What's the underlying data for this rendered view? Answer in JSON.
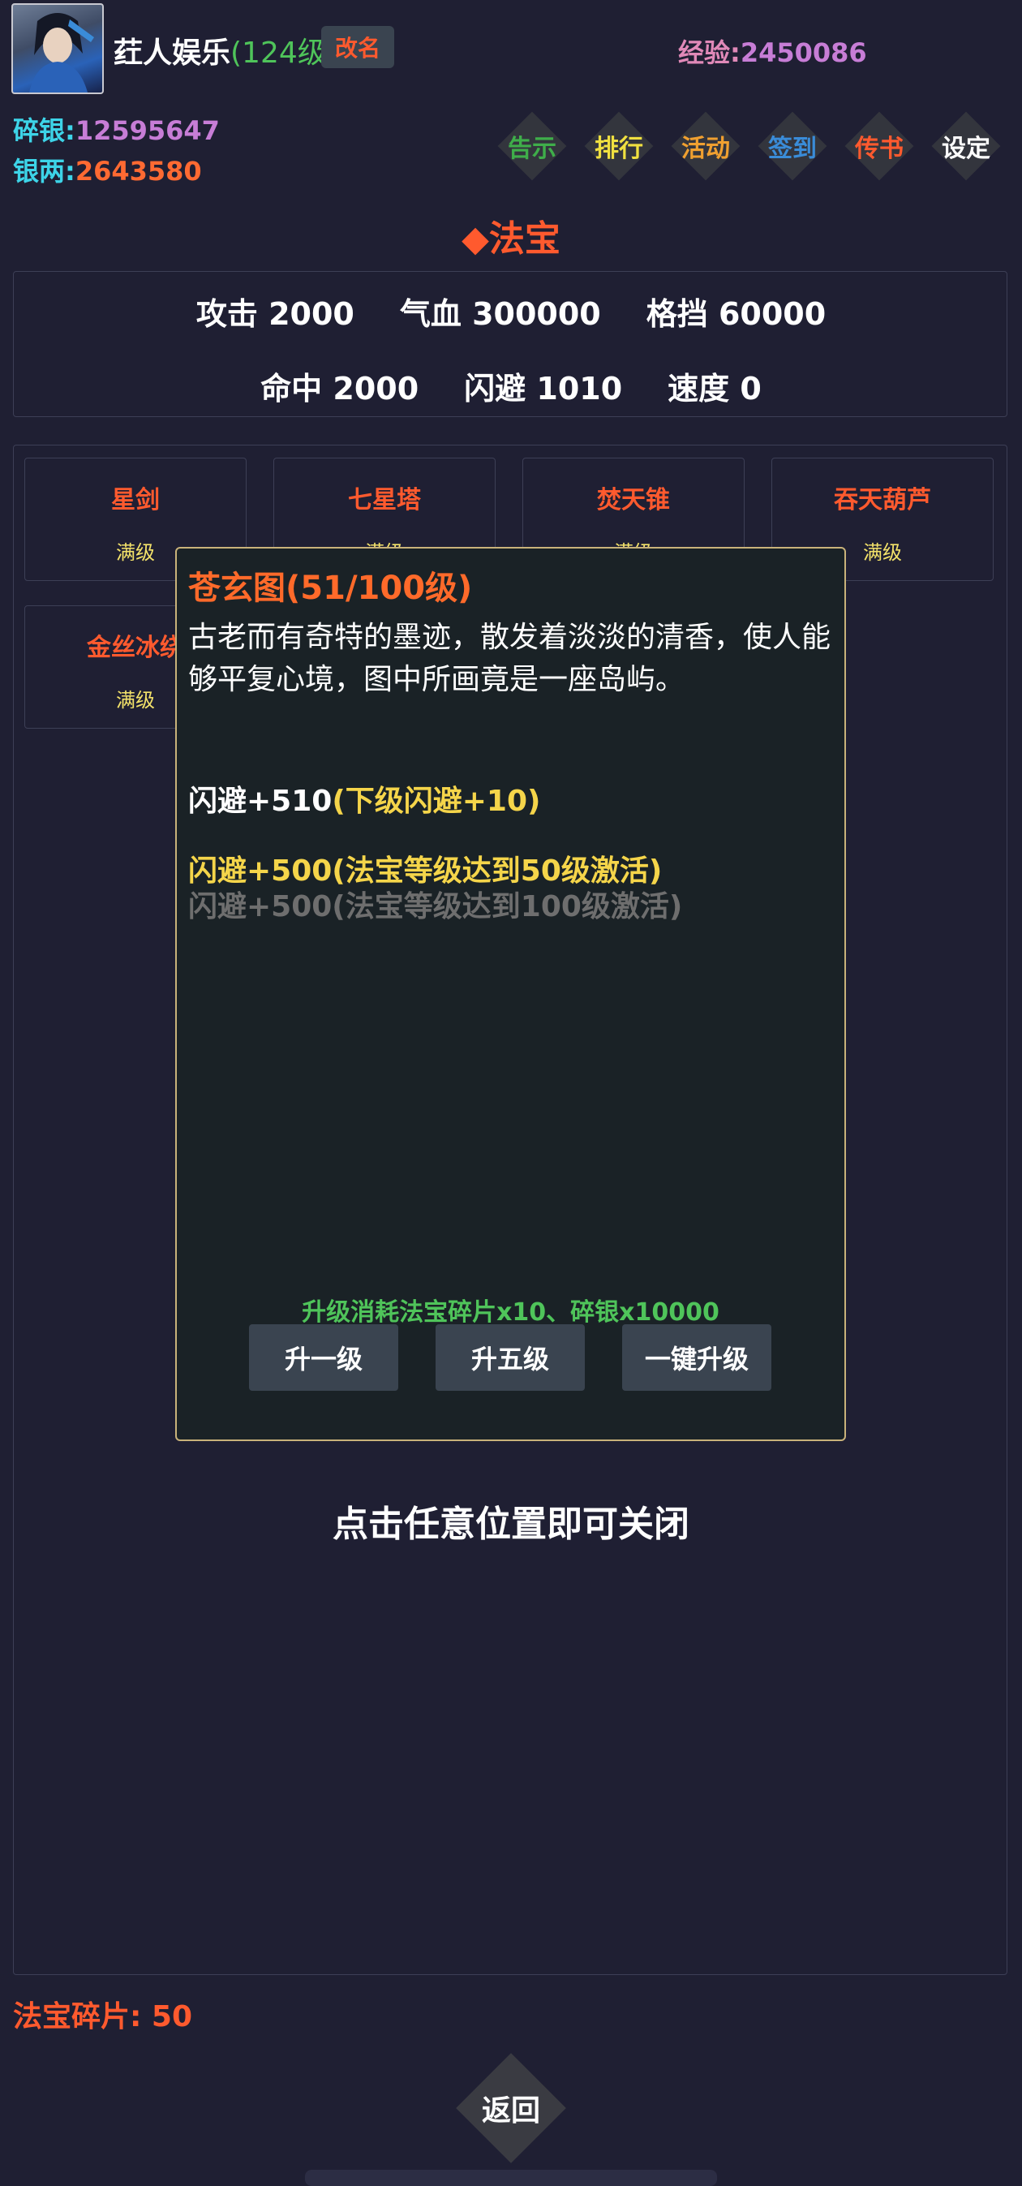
{
  "header": {
    "player_name": "荭人娱乐",
    "player_level": "(124级)",
    "rename_label": "改名",
    "exp_label": "经验:",
    "exp_value": "2450086",
    "silver_label": "碎银:",
    "silver_value": "12595647",
    "money_label": "银两:",
    "money_value": "2643580"
  },
  "menu": [
    {
      "label": "告示",
      "color": "#3fae4a"
    },
    {
      "label": "排行",
      "color": "#f0e040"
    },
    {
      "label": "活动",
      "color": "#f0a030"
    },
    {
      "label": "签到",
      "color": "#3a8cd8"
    },
    {
      "label": "传书",
      "color": "#ff5a2e"
    },
    {
      "label": "设定",
      "color": "#ffffff"
    }
  ],
  "page": {
    "title_icon": "◆",
    "title": "法宝"
  },
  "stats": {
    "row1": [
      "攻击 2000",
      "气血 300000",
      "格挡 60000"
    ],
    "row2": [
      "命中 2000",
      "闪避 1010",
      "速度 0"
    ]
  },
  "treasures": [
    {
      "name": "星剑",
      "level": "满级"
    },
    {
      "name": "七星塔",
      "level": "满级"
    },
    {
      "name": "焚天锥",
      "level": "满级"
    },
    {
      "name": "吞天葫芦",
      "level": "满级"
    },
    {
      "name": "金丝冰绕",
      "level": "满级"
    }
  ],
  "popup": {
    "title": "苍玄图(51/100级)",
    "description": "古老而有奇特的墨迹，散发着淡淡的清香，使人能够平复心境，图中所画竟是一座岛屿。",
    "effect_current": "闪避+510",
    "effect_next": "(下级闪避+10)",
    "bonus_active": "闪避+500(法宝等级达到50级激活)",
    "bonus_inactive": "闪避+500(法宝等级达到100级激活)",
    "cost": "升级消耗法宝碎片x10、碎银x10000",
    "buttons": [
      "升一级",
      "升五级",
      "一键升级"
    ]
  },
  "close_hint": "点击任意位置即可关闭",
  "footer": {
    "fragments": "法宝碎片: 50",
    "back_label": "返回"
  }
}
